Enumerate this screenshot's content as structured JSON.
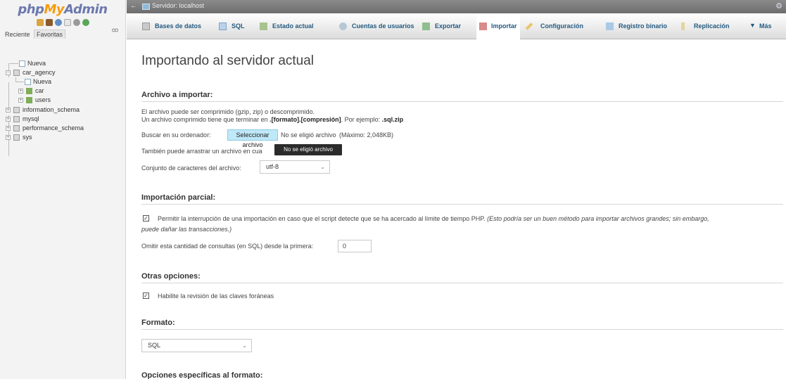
{
  "sidebar": {
    "logo": {
      "php": "php",
      "my": "My",
      "admin": "Admin"
    },
    "tabs": {
      "recent": "Reciente",
      "favorites": "Favoritas"
    },
    "tree": [
      {
        "label": "Nueva",
        "level": 1
      },
      {
        "label": "car_agency",
        "level": 0
      },
      {
        "label": "Nueva",
        "level": 2
      },
      {
        "label": "car",
        "level": 2
      },
      {
        "label": "users",
        "level": 2
      },
      {
        "label": "information_schema",
        "level": 0
      },
      {
        "label": "mysql",
        "level": 0
      },
      {
        "label": "performance_schema",
        "level": 0
      },
      {
        "label": "sys",
        "level": 0
      }
    ]
  },
  "topbar": {
    "server": "Servidor: localhost"
  },
  "nav": {
    "tabs": [
      {
        "label": "Bases de datos"
      },
      {
        "label": "SQL"
      },
      {
        "label": "Estado actual"
      },
      {
        "label": "Cuentas de usuarios"
      },
      {
        "label": "Exportar"
      },
      {
        "label": "Importar"
      },
      {
        "label": "Configuración"
      },
      {
        "label": "Registro binario"
      },
      {
        "label": "Replicación"
      },
      {
        "label": "Más"
      }
    ]
  },
  "main": {
    "title": "Importando al servidor actual",
    "file_section": {
      "heading": "Archivo a importar:",
      "line1": "El archivo puede ser comprimido (gzip, zip) o descomprimido.",
      "line2_a": "Un archivo comprimido tiene que terminar en ",
      "line2_b": ".[formato].[compresión]",
      "line2_c": ". Por ejemplo: ",
      "line2_d": ".sql.zip",
      "browse_label": "Buscar en su ordenador:",
      "browse_button": "Seleccionar archivo",
      "no_file": "No se eligió archivo",
      "max_size": "(Máximo: 2,048KB)",
      "drag_text": "También puede arrastrar un archivo en cua",
      "tooltip": "No se eligió archivo",
      "charset_label": "Conjunto de caracteres del archivo:",
      "charset_value": "utf-8"
    },
    "partial_section": {
      "heading": "Importación parcial:",
      "allow_interrupt": "Permitir la interrupción de una importación en caso que el script detecte que se ha acercado al límite de tiempo PHP.",
      "allow_interrupt_note_1": "(Esto podría ser un buen método para importar archivos grandes; sin embargo,",
      "allow_interrupt_note_2": "puede dañar las transacciones.)",
      "skip_label": "Omitir esta cantidad de consultas (en SQL) desde la primera:",
      "skip_value": "0"
    },
    "other_section": {
      "heading": "Otras opciones:",
      "foreign_keys": "Habilite la revisión de las claves foráneas"
    },
    "format_section": {
      "heading": "Formato:",
      "format_value": "SQL"
    },
    "format_specific": {
      "heading": "Opciones específicas al formato:"
    }
  },
  "colors": {
    "link_blue": "#235a81",
    "logo_blue": "#6c78af",
    "logo_orange": "#f89c0e",
    "file_button_bg": "#bfe8f8"
  }
}
